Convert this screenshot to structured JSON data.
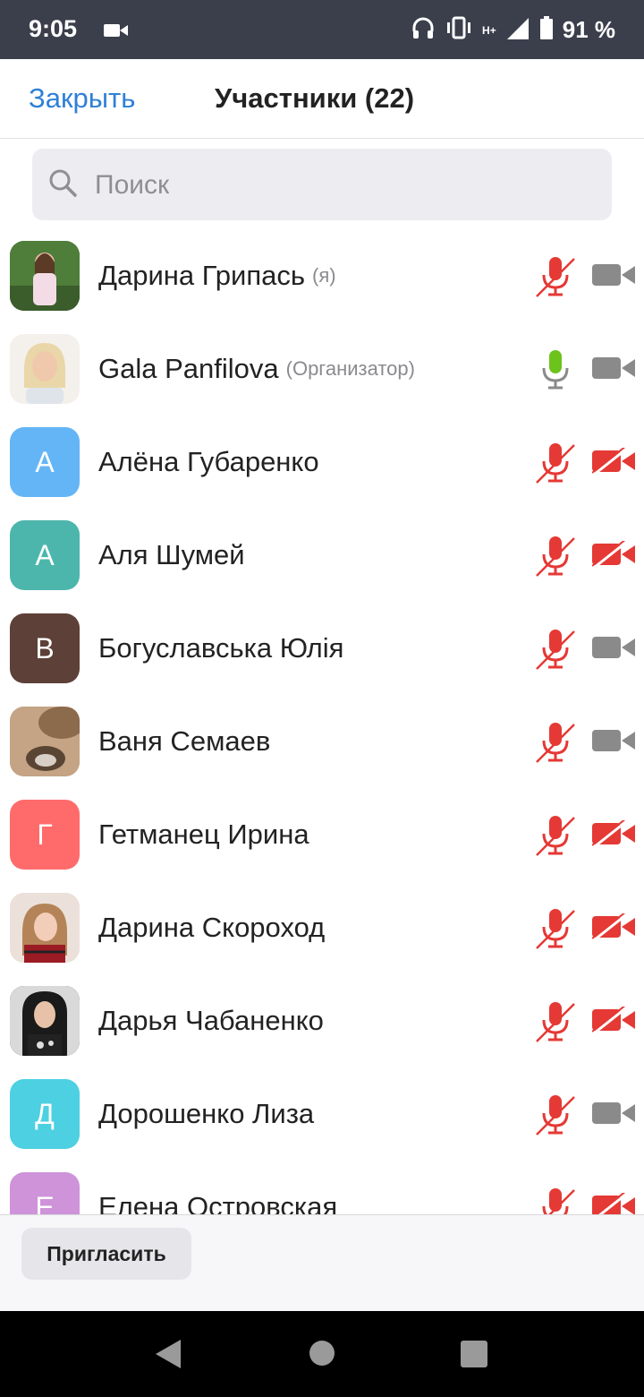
{
  "status_bar": {
    "time": "9:05",
    "network": "H+",
    "battery": "91 %"
  },
  "header": {
    "close_label": "Закрыть",
    "title": "Участники (22)"
  },
  "search": {
    "placeholder": "Поиск"
  },
  "colors": {
    "accent": "#2f80d6",
    "muted_red": "#e53935",
    "unmuted_green": "#6cc31c",
    "video_on_gray": "#8a8a8a"
  },
  "participants": [
    {
      "name": "Дарина Грипась",
      "role": "(я)",
      "avatar": "photo",
      "mic": "muted",
      "video": "on"
    },
    {
      "name": "Gala Panfilova",
      "role": "(Организатор)",
      "avatar": "photo",
      "mic": "on",
      "video": "on"
    },
    {
      "name": "Алёна Губаренко",
      "role": "",
      "avatar_letter": "А",
      "avatar_color": "#64b5f6",
      "mic": "muted",
      "video": "off"
    },
    {
      "name": "Аля Шумей",
      "role": "",
      "avatar_letter": "А",
      "avatar_color": "#4db6ac",
      "mic": "muted",
      "video": "off"
    },
    {
      "name": "Богуславська Юлія",
      "role": "",
      "avatar_letter": "В",
      "avatar_color": "#5d4037",
      "mic": "muted",
      "video": "on"
    },
    {
      "name": "Ваня Семаев",
      "role": "",
      "avatar": "photo",
      "mic": "muted",
      "video": "on"
    },
    {
      "name": "Гетманец Ирина",
      "role": "",
      "avatar_letter": "Г",
      "avatar_color": "#ff6b6b",
      "mic": "muted",
      "video": "off"
    },
    {
      "name": "Дарина Скороход",
      "role": "",
      "avatar": "photo",
      "mic": "muted",
      "video": "off"
    },
    {
      "name": "Дарья Чабаненко",
      "role": "",
      "avatar": "photo",
      "mic": "muted",
      "video": "off"
    },
    {
      "name": "Дорошенко Лиза",
      "role": "",
      "avatar_letter": "Д",
      "avatar_color": "#4dd0e1",
      "mic": "muted",
      "video": "on"
    },
    {
      "name": "Елена Островская",
      "role": "",
      "avatar_letter": "Е",
      "avatar_color": "#ce93d8",
      "mic": "muted",
      "video": "off"
    }
  ],
  "footer": {
    "invite_label": "Пригласить"
  }
}
